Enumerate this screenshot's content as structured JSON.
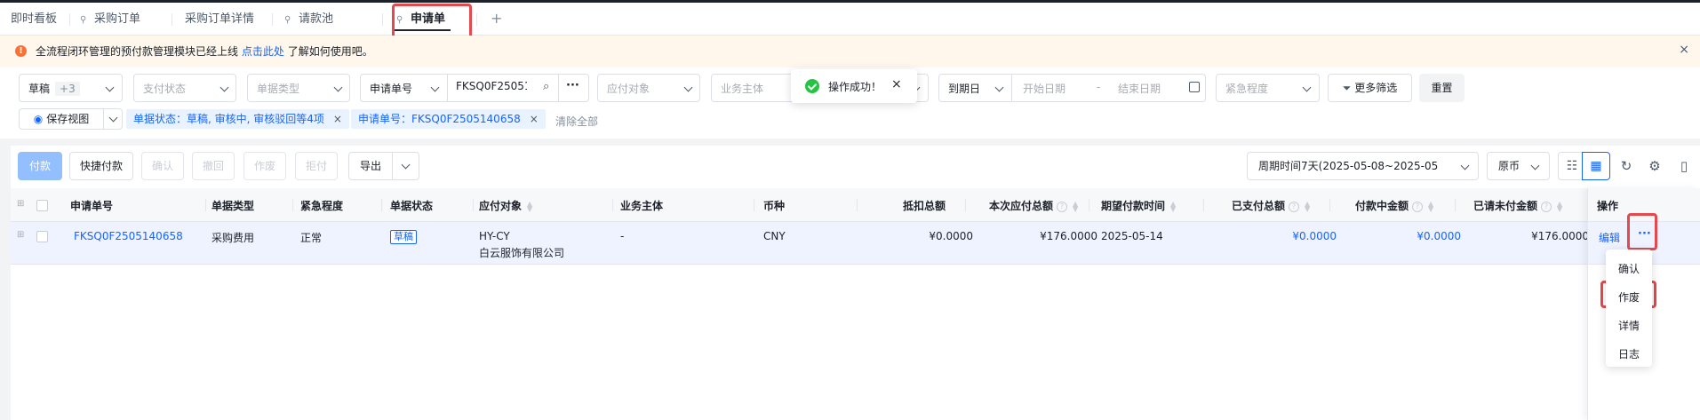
{
  "tabs": [
    {
      "label": "即时看板",
      "pinned": false,
      "active": false
    },
    {
      "label": "采购订单",
      "pinned": true,
      "active": false
    },
    {
      "label": "采购订单详情",
      "pinned": false,
      "active": false
    },
    {
      "label": "请款池",
      "pinned": true,
      "active": false
    },
    {
      "label": "申请单",
      "pinned": true,
      "active": true
    }
  ],
  "tab_add": "+",
  "notice": {
    "icon": "warning-icon",
    "text_before": "全流程闭环管理的预付款管理模块已经上线",
    "link": "点击此处",
    "text_after": "了解如何使用吧。",
    "close": "×"
  },
  "filters": {
    "status": {
      "value": "草稿",
      "extra": "+3"
    },
    "pay_status": {
      "placeholder": "支付状态"
    },
    "doc_type": {
      "placeholder": "单据类型"
    },
    "search_field": {
      "value": "申请单号"
    },
    "search_value": "FKSQ0F2505140658",
    "more_icon": "···",
    "payee": {
      "placeholder": "应付对象"
    },
    "entity": {
      "placeholder": "业务主体"
    },
    "date_type": {
      "value": "到期日"
    },
    "date_start": {
      "placeholder": "开始日期"
    },
    "date_sep": "-",
    "date_end": {
      "placeholder": "结束日期"
    },
    "urgency": {
      "placeholder": "紧急程度"
    },
    "more_filter": "更多筛选",
    "reset": "重置",
    "save_view": "保存视图",
    "chips": [
      {
        "text": "单据状态：草稿, 审核中, 审核驳回等4项"
      },
      {
        "text": "申请单号：FKSQ0F2505140658"
      }
    ],
    "clear_all": "清除全部"
  },
  "toast": {
    "text": "操作成功！",
    "close": "×"
  },
  "toolbar": {
    "pay": "付款",
    "quick_pay": "快捷付款",
    "confirm": "确认",
    "withdraw": "撤回",
    "void": "作废",
    "reject": "拒付",
    "export": "导出",
    "period": "周期时间7天(2025-05-08~2025-05",
    "currency": "原币"
  },
  "table": {
    "headers": {
      "doc_no": "申请单号",
      "doc_type": "单据类型",
      "urgency": "紧急程度",
      "status": "单据状态",
      "payee": "应付对象",
      "entity": "业务主体",
      "currency": "币种",
      "deduct_total": "抵扣总额",
      "payable_total": "本次应付总额",
      "expected_date": "期望付款时间",
      "paid_total": "已支付总额",
      "paying_amount": "付款中金额",
      "unpaid_total": "已请未付金额",
      "ops": "操作"
    },
    "rows": [
      {
        "doc_no": "FKSQ0F2505140658",
        "doc_type": "采购费用",
        "urgency": "正常",
        "status": "草稿",
        "payee_code": "HY-CY",
        "payee_name": "白云服饰有限公司",
        "entity": "-",
        "currency": "CNY",
        "deduct_total": "¥0.0000",
        "payable_total": "¥176.0000",
        "expected_date": "2025-05-14",
        "paid_total": "¥0.0000",
        "paying_amount": "¥0.0000",
        "unpaid_total": "¥176.0000",
        "edit": "编辑",
        "more": "···"
      }
    ]
  },
  "row_menu": [
    "确认",
    "作废",
    "详情",
    "日志"
  ],
  "colors": {
    "accent": "#1664ff",
    "highlight": "#e5484d",
    "success": "#23c343",
    "warning": "#f77234"
  }
}
